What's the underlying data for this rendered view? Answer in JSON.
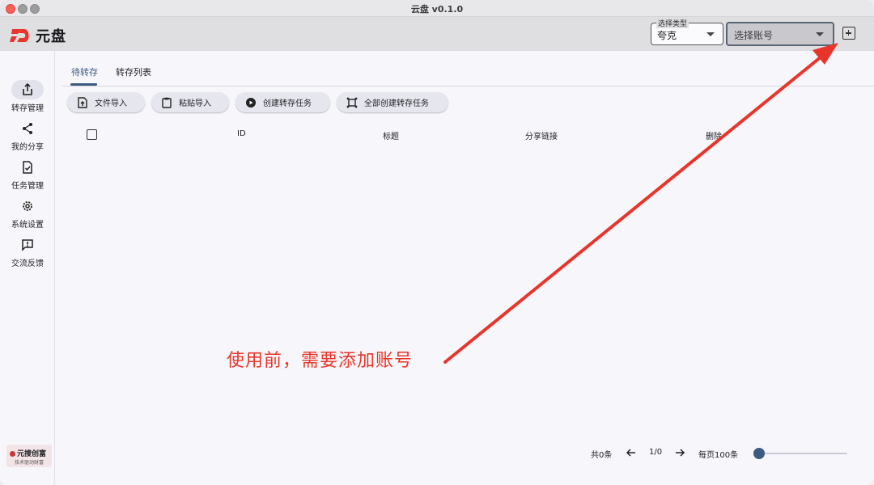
{
  "window": {
    "title": "云盘 v0.1.0"
  },
  "header": {
    "logo_text": "元盘",
    "type_select": {
      "legend": "选择类型",
      "value": "夸克"
    },
    "account_select": {
      "placeholder": "选择账号"
    },
    "add_icon": "plus-square-icon"
  },
  "sidebar": {
    "items": [
      {
        "label": "转存管理",
        "icon": "share-upload-icon",
        "active": true
      },
      {
        "label": "我的分享",
        "icon": "share-icon",
        "active": false
      },
      {
        "label": "任务管理",
        "icon": "task-check-icon",
        "active": false
      },
      {
        "label": "系统设置",
        "icon": "gear-icon",
        "active": false
      },
      {
        "label": "交流反馈",
        "icon": "feedback-icon",
        "active": false
      }
    ],
    "brand": {
      "name": "元搜创富",
      "tagline": "技术驱动财富"
    }
  },
  "main": {
    "tabs": [
      {
        "label": "待转存",
        "active": true
      },
      {
        "label": "转存列表",
        "active": false
      }
    ],
    "toolbar": [
      {
        "label": "文件导入",
        "icon": "file-upload-icon"
      },
      {
        "label": "粘贴导入",
        "icon": "clipboard-icon"
      },
      {
        "label": "创建转存任务",
        "icon": "play-circle-icon"
      },
      {
        "label": "全部创建转存任务",
        "icon": "select-all-icon"
      }
    ],
    "table": {
      "columns": [
        "ID",
        "标题",
        "分享链接",
        "删除"
      ],
      "rows": []
    }
  },
  "pagination": {
    "total": "共0条",
    "page": "1/0",
    "per_page": "每页100条",
    "per_page_slider": 0
  },
  "annotation": {
    "text": "使用前，需要添加账号",
    "color": "#e8352b"
  },
  "colors": {
    "accent": "#3d5a80",
    "annotation": "#e8352b"
  }
}
